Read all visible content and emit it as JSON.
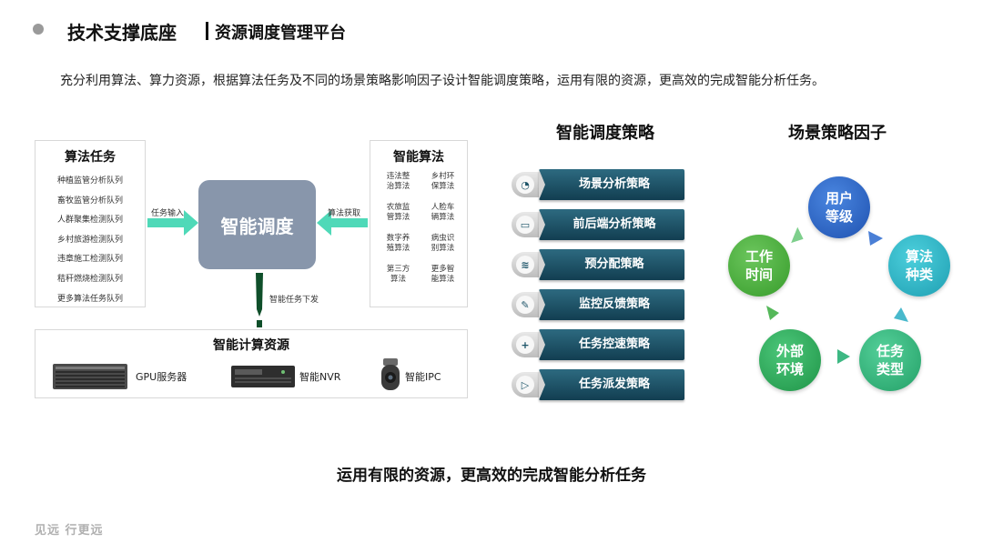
{
  "header": {
    "title": "技术支撑底座",
    "subtitle": "资源调度管理平台",
    "intro": "充分利用算法、算力资源，根据算法任务及不同的场景策略影响因子设计智能调度策略，运用有限的资源，更高效的完成智能分析任务。"
  },
  "tasks": {
    "title": "算法任务",
    "items": [
      "种植监管分析队列",
      "畜牧监管分析队列",
      "人群聚集检测队列",
      "乡村旅游检测队列",
      "违章施工检测队列",
      "秸秆燃烧检测队列",
      "更多算法任务队列"
    ]
  },
  "scheduler": {
    "label": "智能调度",
    "task_input": "任务输入",
    "algo_fetch": "算法获取",
    "task_dispatch": "智能任务下发"
  },
  "algorithms": {
    "title": "智能算法",
    "items": [
      "违法整\n治算法",
      "乡村环\n保算法",
      "农旅监\n管算法",
      "人脸车\n辆算法",
      "数字养\n殖算法",
      "病虫识\n别算法",
      "第三方\n算法",
      "更多智\n能算法"
    ]
  },
  "resources": {
    "title": "智能计算资源",
    "devices": [
      "GPU服务器",
      "智能NVR",
      "智能IPC"
    ]
  },
  "strategies": {
    "title": "智能调度策略",
    "items": [
      {
        "label": "场景分析策略",
        "icon": "pie-chart-icon",
        "glyph": "◔"
      },
      {
        "label": "前后端分析策略",
        "icon": "id-card-icon",
        "glyph": "▭"
      },
      {
        "label": "预分配策略",
        "icon": "database-icon",
        "glyph": "≋"
      },
      {
        "label": "监控反馈策略",
        "icon": "edit-icon",
        "glyph": "✎"
      },
      {
        "label": "任务控速策略",
        "icon": "plus-circle-icon",
        "glyph": "+"
      },
      {
        "label": "任务派发策略",
        "icon": "media-play-icon",
        "glyph": "▷"
      }
    ]
  },
  "factors": {
    "title": "场景策略因子",
    "items": [
      {
        "label": "用户\n等级",
        "color": "#2f66c6"
      },
      {
        "label": "算法\n种类",
        "color": "#2fb4c4"
      },
      {
        "label": "任务\n类型",
        "color": "#36b57a"
      },
      {
        "label": "外部\n环境",
        "color": "#2fa85c"
      },
      {
        "label": "工作\n时间",
        "color": "#4cae3e"
      }
    ]
  },
  "tagline": "运用有限的资源，更高效的完成智能分析任务",
  "footer": "见远 行更远"
}
